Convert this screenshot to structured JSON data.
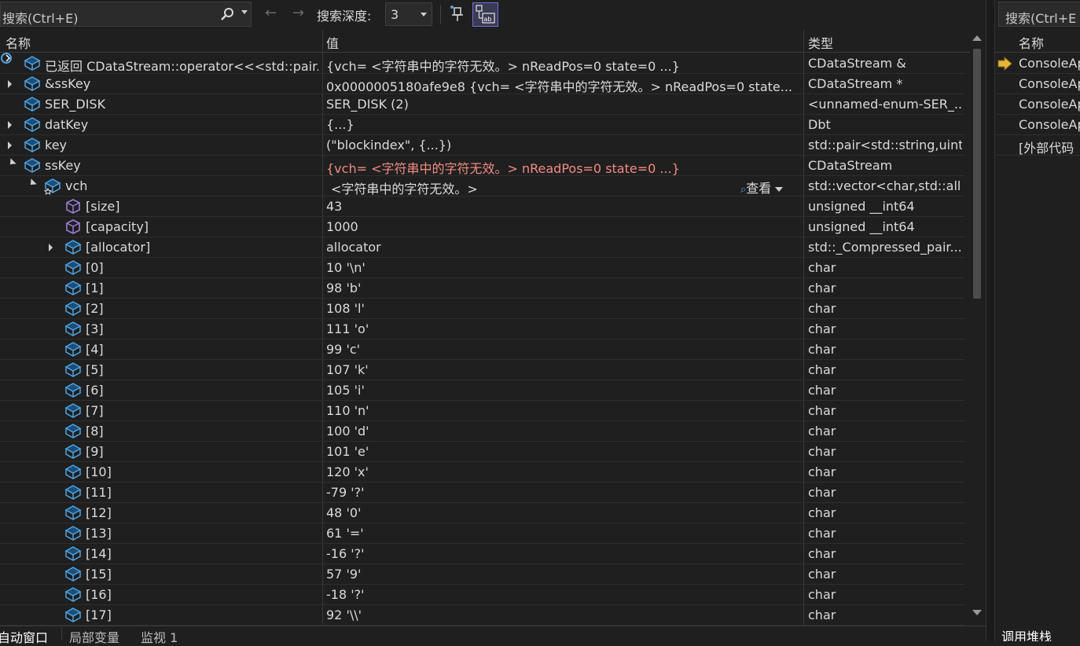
{
  "toolbar": {
    "search_placeholder": "搜索(Ctrl+E)",
    "back_arrow": "←",
    "forward_arrow": "→",
    "depth_label": "搜索深度:",
    "depth_value": "3"
  },
  "columns": {
    "name": "名称",
    "value": "值",
    "type": "类型"
  },
  "rows": [
    {
      "name": "已返回 CDataStream::operator<<<std::pair...",
      "value": "{vch= <字符串中的字符无效。> nReadPos=0 state=0 ...}",
      "type": "CDataStream &"
    },
    {
      "name": "&ssKey",
      "value": "0x0000005180afe9e8 {vch= <字符串中的字符无效。> nReadPos=0 state...",
      "type": "CDataStream *"
    },
    {
      "name": "SER_DISK",
      "value": "SER_DISK (2)",
      "type": "<unnamed-enum-SER_..."
    },
    {
      "name": "datKey",
      "value": "{...}",
      "type": "Dbt"
    },
    {
      "name": "key",
      "value": "(\"blockindex\", {...})",
      "type": "std::pair<std::string,uint..."
    },
    {
      "name": "ssKey",
      "value": "{vch= <字符串中的字符无效。> nReadPos=0 state=0 ...}",
      "type": "CDataStream"
    },
    {
      "name": "vch",
      "value": "<字符串中的字符无效。>",
      "type": "std::vector<char,std::all..."
    },
    {
      "name": "[size]",
      "value": "43",
      "type": "unsigned __int64"
    },
    {
      "name": "[capacity]",
      "value": "1000",
      "type": "unsigned __int64"
    },
    {
      "name": "[allocator]",
      "value": "allocator",
      "type": "std::_Compressed_pair..."
    },
    {
      "name": "[0]",
      "value": "10 '\\n'",
      "type": "char"
    },
    {
      "name": "[1]",
      "value": "98 'b'",
      "type": "char"
    },
    {
      "name": "[2]",
      "value": "108 'l'",
      "type": "char"
    },
    {
      "name": "[3]",
      "value": "111 'o'",
      "type": "char"
    },
    {
      "name": "[4]",
      "value": "99 'c'",
      "type": "char"
    },
    {
      "name": "[5]",
      "value": "107 'k'",
      "type": "char"
    },
    {
      "name": "[6]",
      "value": "105 'i'",
      "type": "char"
    },
    {
      "name": "[7]",
      "value": "110 'n'",
      "type": "char"
    },
    {
      "name": "[8]",
      "value": "100 'd'",
      "type": "char"
    },
    {
      "name": "[9]",
      "value": "101 'e'",
      "type": "char"
    },
    {
      "name": "[10]",
      "value": "120 'x'",
      "type": "char"
    },
    {
      "name": "[11]",
      "value": "-79 '?'",
      "type": "char"
    },
    {
      "name": "[12]",
      "value": "48 '0'",
      "type": "char"
    },
    {
      "name": "[13]",
      "value": "61 '='",
      "type": "char"
    },
    {
      "name": "[14]",
      "value": "-16 '?'",
      "type": "char"
    },
    {
      "name": "[15]",
      "value": "57 '9'",
      "type": "char"
    },
    {
      "name": "[16]",
      "value": "-18 '?'",
      "type": "char"
    },
    {
      "name": "[17]",
      "value": "92 '\\\\'",
      "type": "char"
    }
  ],
  "view_button": "查看",
  "bottom_tabs": [
    "自动窗口",
    "局部变量",
    "监视 1"
  ],
  "right_panel": {
    "search_placeholder": "搜索(Ctrl+E",
    "header": "名称",
    "rows": [
      "ConsoleAp",
      "ConsoleAp",
      "ConsoleAp",
      "ConsoleAp",
      "[外部代码"
    ],
    "tab": "调用堆栈"
  },
  "colors": {
    "background": "#1f1f1f",
    "changed_value": "#f28b82",
    "icon_blue": "#4fa3e0",
    "icon_purple": "#9b7fd4",
    "current_frame_arrow": "#e8b63a"
  }
}
